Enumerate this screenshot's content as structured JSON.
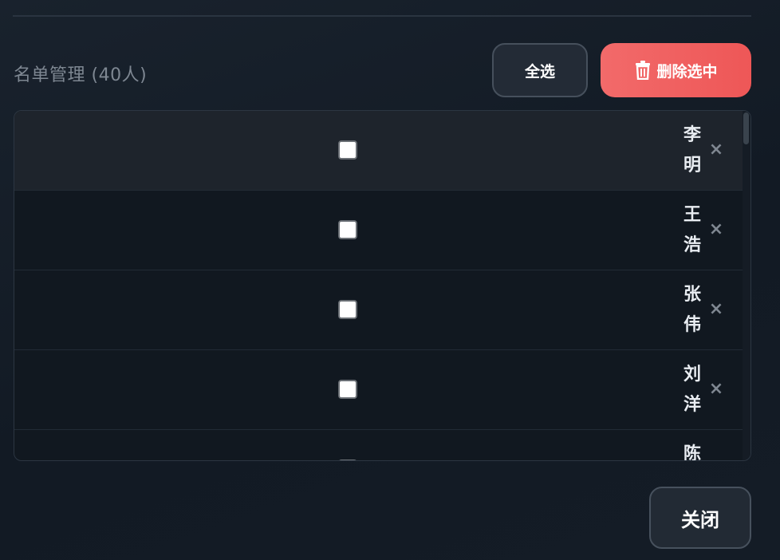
{
  "header": {
    "title": "名单管理 (40人)",
    "select_all_label": "全选",
    "delete_selected_label": "删除选中"
  },
  "list": {
    "items": [
      {
        "name": "李明",
        "checked": false
      },
      {
        "name": "王浩",
        "checked": false
      },
      {
        "name": "张伟",
        "checked": false
      },
      {
        "name": "刘洋",
        "checked": false
      },
      {
        "name": "陈",
        "checked": false
      }
    ],
    "remove_glyph": "×"
  },
  "footer": {
    "close_label": "关闭"
  },
  "colors": {
    "accent_danger": "#f26a6a",
    "background": "#161e28"
  }
}
